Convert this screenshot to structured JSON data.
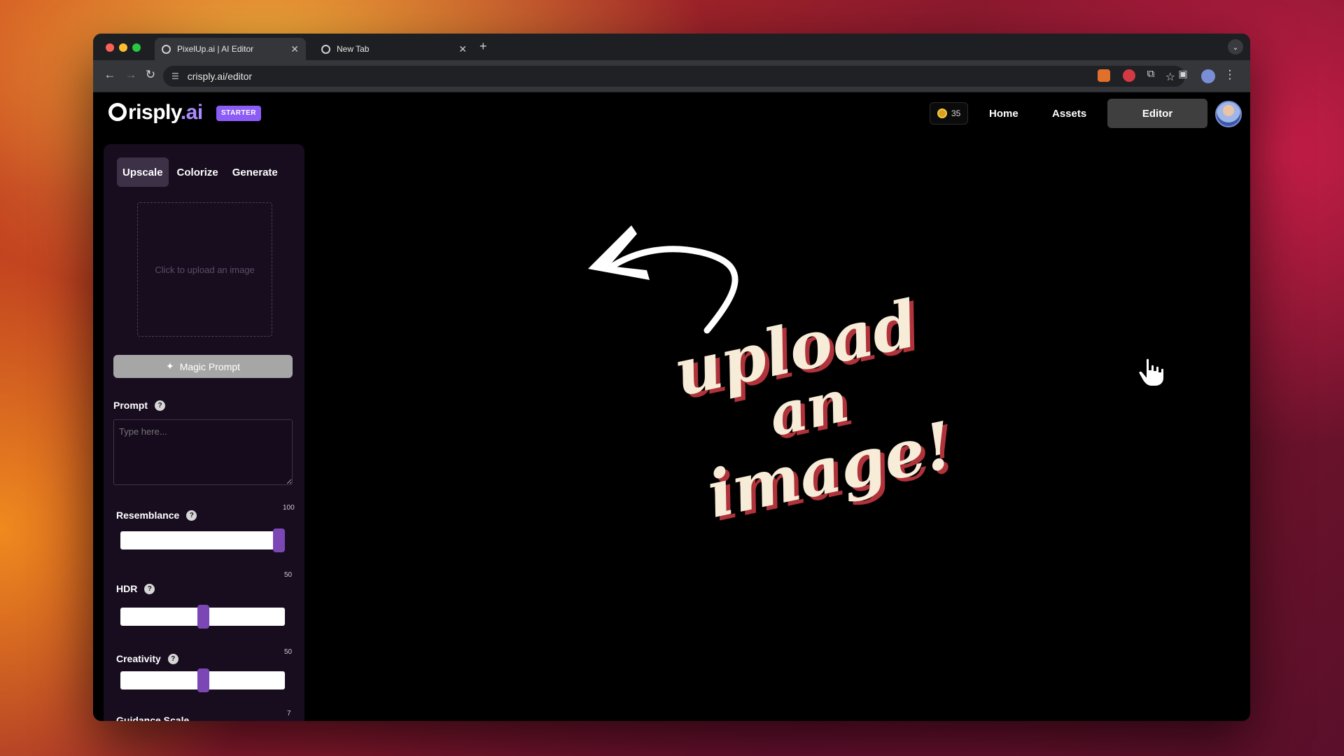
{
  "browser": {
    "tabs": [
      {
        "title": "PixelUp.ai | AI Editor",
        "active": true
      },
      {
        "title": "New Tab",
        "active": false
      }
    ],
    "url": "crisply.ai/editor"
  },
  "header": {
    "logo_main": "risply",
    "logo_suffix": ".ai",
    "plan_badge": "STARTER",
    "credits": "35",
    "nav": [
      "Home",
      "Assets",
      "Editor"
    ],
    "active_nav": "Editor"
  },
  "sidebar": {
    "tabs": [
      "Upscale",
      "Colorize",
      "Generate"
    ],
    "active_tab": "Upscale",
    "upload_placeholder": "Click to upload an image",
    "magic_prompt_label": "Magic Prompt",
    "prompt": {
      "label": "Prompt",
      "placeholder": "Type here..."
    },
    "sliders": [
      {
        "label": "Resemblance",
        "value": 100,
        "max": 100
      },
      {
        "label": "HDR",
        "value": 50,
        "max": 100
      },
      {
        "label": "Creativity",
        "value": 50,
        "max": 100
      },
      {
        "label": "Guidance Scale",
        "value": 7
      }
    ]
  },
  "canvas": {
    "overlay_text": [
      "upload",
      "an",
      "image!"
    ]
  },
  "colors": {
    "accent": "#8b5cf6",
    "slider_thumb": "#7b47b5",
    "sidebar_bg": "#180d1f"
  }
}
